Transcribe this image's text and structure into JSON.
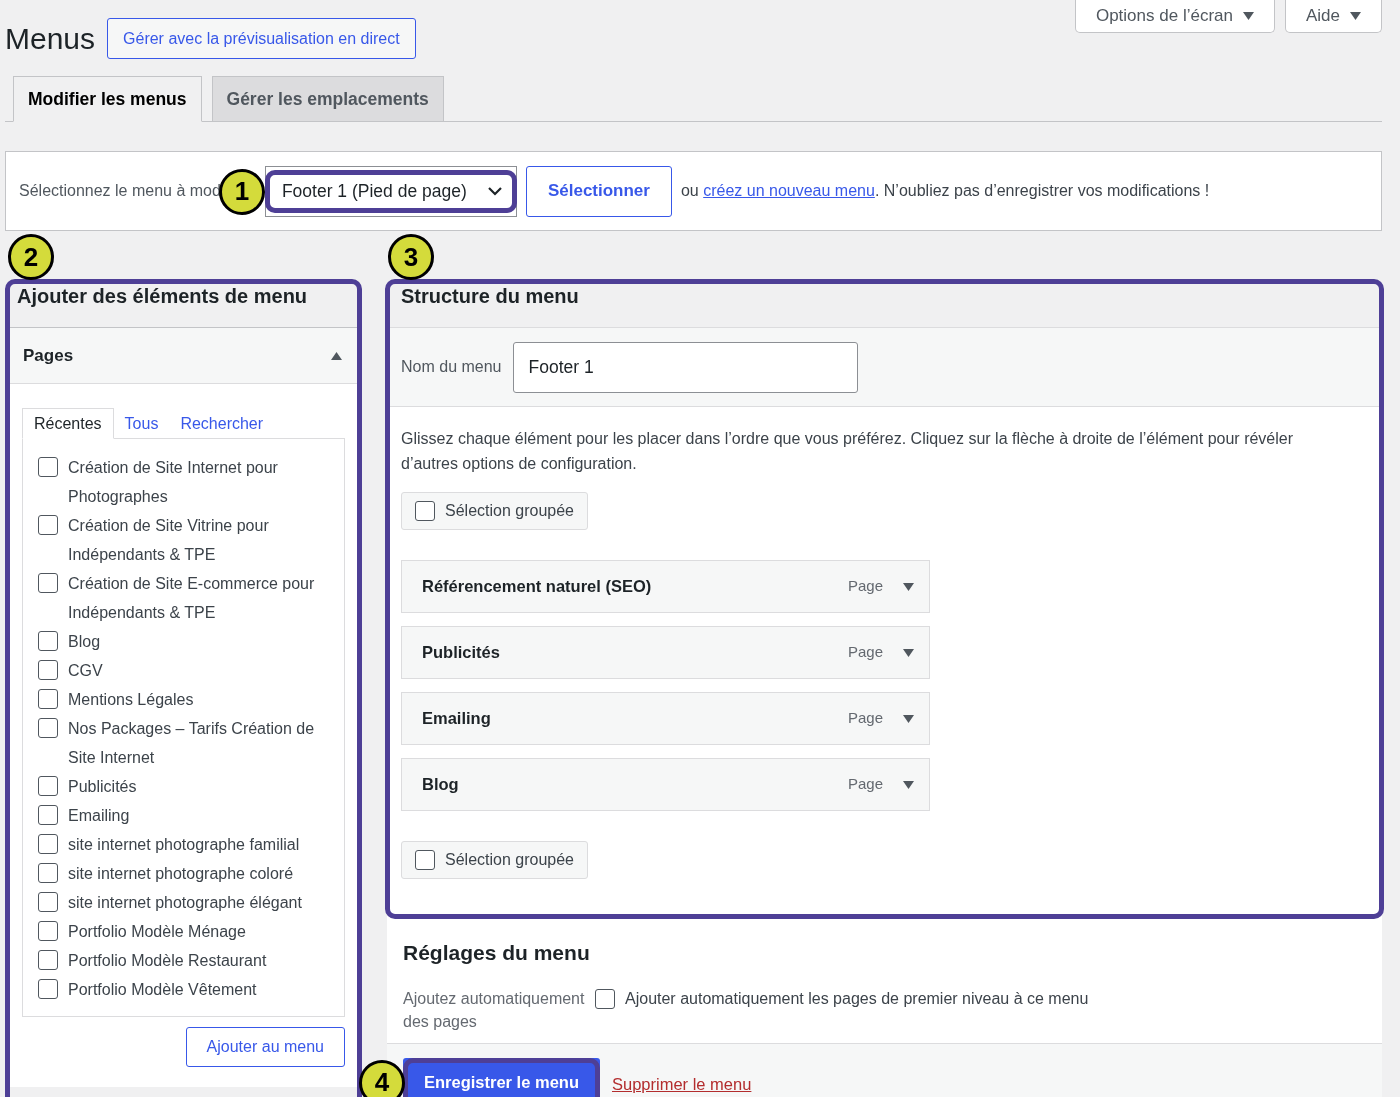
{
  "page": {
    "title": "Menus",
    "live_preview_button": "Gérer avec la prévisualisation en direct"
  },
  "screen_meta": [
    {
      "label": "Options de l’écran"
    },
    {
      "label": "Aide"
    }
  ],
  "tabs": [
    {
      "label": "Modifier les menus",
      "selected": true
    },
    {
      "label": "Gérer les emplacements",
      "selected": false
    }
  ],
  "select_bar": {
    "label": "Sélectionnez le menu à mod",
    "value": "Footer 1 (Pied de page)",
    "highlighted": true,
    "badge": "1",
    "button": "Sélectionner",
    "text_before": "ou",
    "link": "créez un nouveau menu",
    "text_after": ". N’oubliez pas d’enregistrer vos modifications !"
  },
  "add_items": {
    "title": "Ajouter des éléments de menu",
    "highlighted": true,
    "badge": "2",
    "section": {
      "title": "Pages",
      "expanded": true,
      "tabs": [
        {
          "label": "Récentes",
          "selected": true
        },
        {
          "label": "Tous",
          "selected": false
        },
        {
          "label": "Rechercher",
          "selected": false
        }
      ],
      "items": [
        {
          "label": "Création de Site Internet pour Photographes",
          "checked": false
        },
        {
          "label": "Création de Site Vitrine pour Indépendants & TPE",
          "checked": false
        },
        {
          "label": "Création de Site E-commerce pour Indépendants & TPE",
          "checked": false
        },
        {
          "label": "Blog",
          "checked": false
        },
        {
          "label": "CGV",
          "checked": false
        },
        {
          "label": "Mentions Légales",
          "checked": false
        },
        {
          "label": "Nos Packages – Tarifs Création de Site Internet",
          "checked": false
        },
        {
          "label": "Publicités",
          "checked": false
        },
        {
          "label": "Emailing",
          "checked": false
        },
        {
          "label": "site internet photographe familial",
          "checked": false
        },
        {
          "label": "site internet photographe coloré",
          "checked": false
        },
        {
          "label": "site internet photographe élégant",
          "checked": false
        },
        {
          "label": "Portfolio Modèle Ménage",
          "checked": false
        },
        {
          "label": "Portfolio Modèle Restaurant",
          "checked": false
        },
        {
          "label": "Portfolio Modèle Vêtement",
          "checked": false
        }
      ],
      "button": "Ajouter au menu"
    }
  },
  "structure": {
    "title": "Structure du menu",
    "highlighted": true,
    "badge": "3",
    "name_label": "Nom du menu",
    "name_value": "Footer 1",
    "instructions": "Glissez chaque élément pour les placer dans l’ordre que vous préférez. Cliquez sur la flèche à droite de l’élément pour révéler d’autres options de configuration.",
    "bulk_select_top": {
      "label": "Sélection groupée",
      "checked": false
    },
    "items": [
      {
        "title": "Référencement naturel (SEO)",
        "type": "Page"
      },
      {
        "title": "Publicités",
        "type": "Page"
      },
      {
        "title": "Emailing",
        "type": "Page"
      },
      {
        "title": "Blog",
        "type": "Page"
      }
    ],
    "bulk_select_bottom": {
      "label": "Sélection groupée",
      "checked": false
    }
  },
  "settings": {
    "title": "Réglages du menu",
    "auto_add_label": "Ajoutez automatiquement des pages",
    "auto_add": {
      "label": "Ajouter automatiquement les pages de premier niveau à ce menu",
      "checked": false
    }
  },
  "footer": {
    "save_button": "Enregistrer le menu",
    "highlighted": true,
    "badge": "4",
    "delete_link": "Supprimer le menu"
  }
}
